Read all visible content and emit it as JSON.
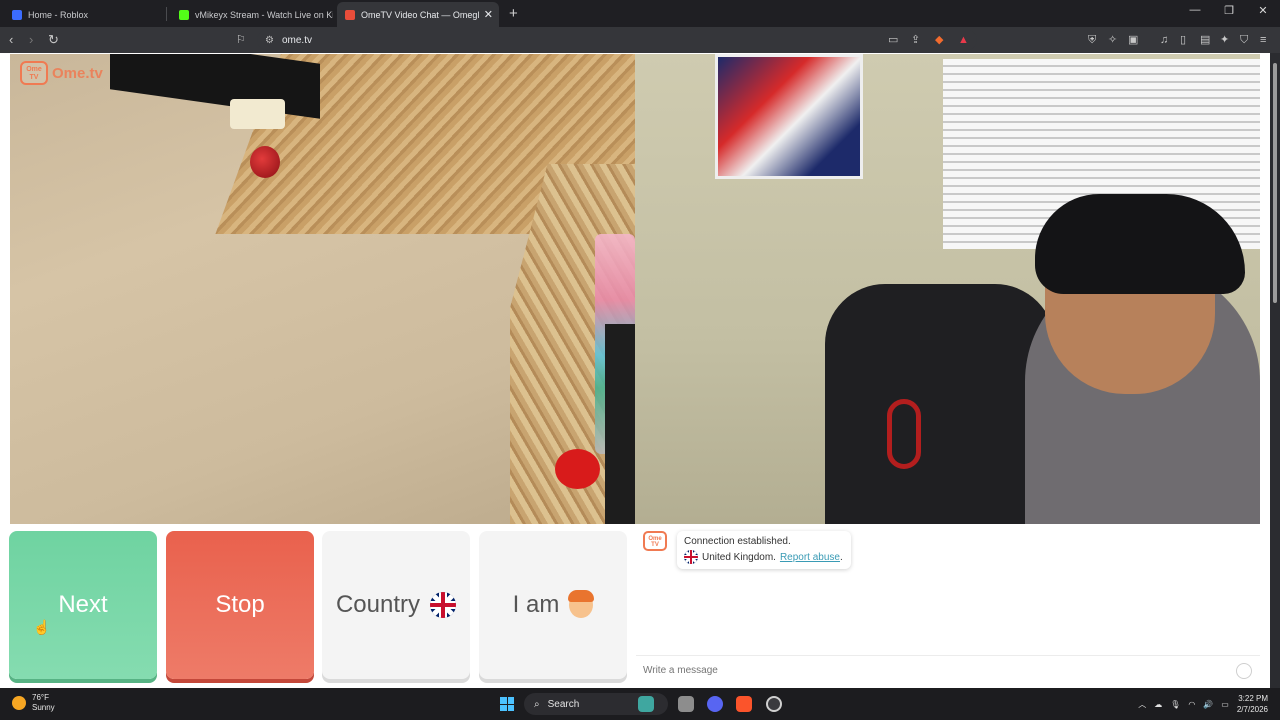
{
  "browser": {
    "tabs": [
      {
        "title": "Home - Roblox",
        "active": false,
        "favicon_color": "#3b6cff"
      },
      {
        "title": "vMikeyx Stream - Watch Live on Kick",
        "active": false,
        "favicon_color": "#53fc18"
      },
      {
        "title": "OmeTV Video Chat — Omegl",
        "active": true,
        "favicon_color": "#e94d3a"
      }
    ],
    "url": "ome.tv",
    "new_tab_icon": "plus-icon"
  },
  "site": {
    "logo_badge": "Ome TV",
    "logo_text": "Ome.tv",
    "accent": "#f07a52"
  },
  "controls": {
    "next": "Next",
    "stop": "Stop",
    "country": "Country",
    "i_am": "I am",
    "next_color": "#6fd3a1",
    "stop_color": "#e9614d"
  },
  "chat": {
    "logo_badge": "Ome TV",
    "status": "Connection established.",
    "country": "United Kingdom.",
    "report": "Report abuse",
    "report_suffix": ".",
    "input_placeholder": "Write a message"
  },
  "taskbar": {
    "temperature": "76°F",
    "condition": "Sunny",
    "search": "Search",
    "time": "3:22 PM",
    "date": "2/7/2026"
  }
}
